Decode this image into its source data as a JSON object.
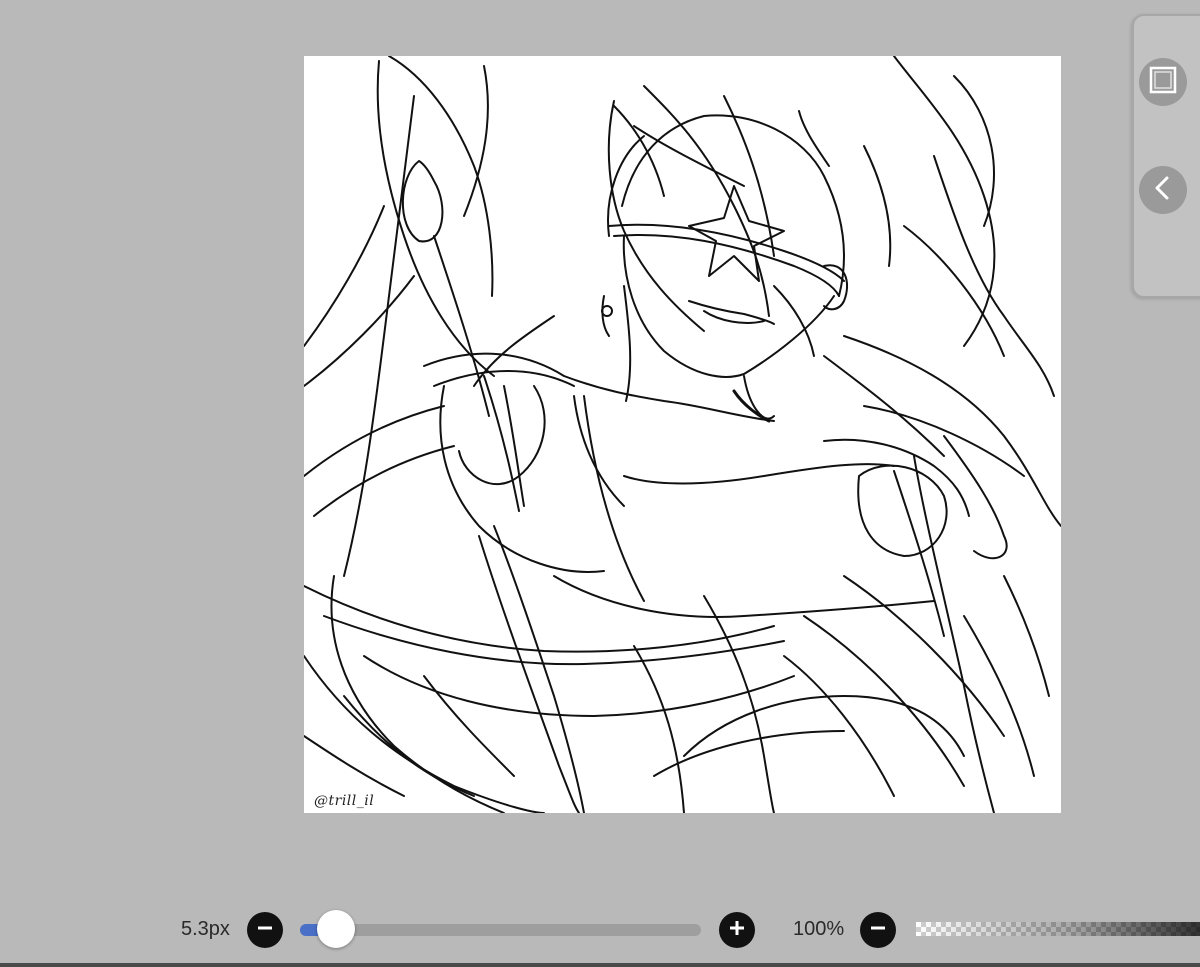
{
  "canvas": {
    "signature": "@trill_il"
  },
  "side_panel": {
    "buttons": [
      {
        "icon": "square-icon"
      },
      {
        "icon": "chevron-left-icon"
      }
    ]
  },
  "toolbar": {
    "brush_size_label": "5.3px",
    "brush_size_slider_value": 0.09,
    "zoom_label": "100%",
    "decrease_icon": "minus-icon",
    "increase_icon": "plus-icon"
  },
  "colors": {
    "background": "#b9b9b9",
    "slider_accent": "#4a6fc6",
    "button": "#111111"
  }
}
